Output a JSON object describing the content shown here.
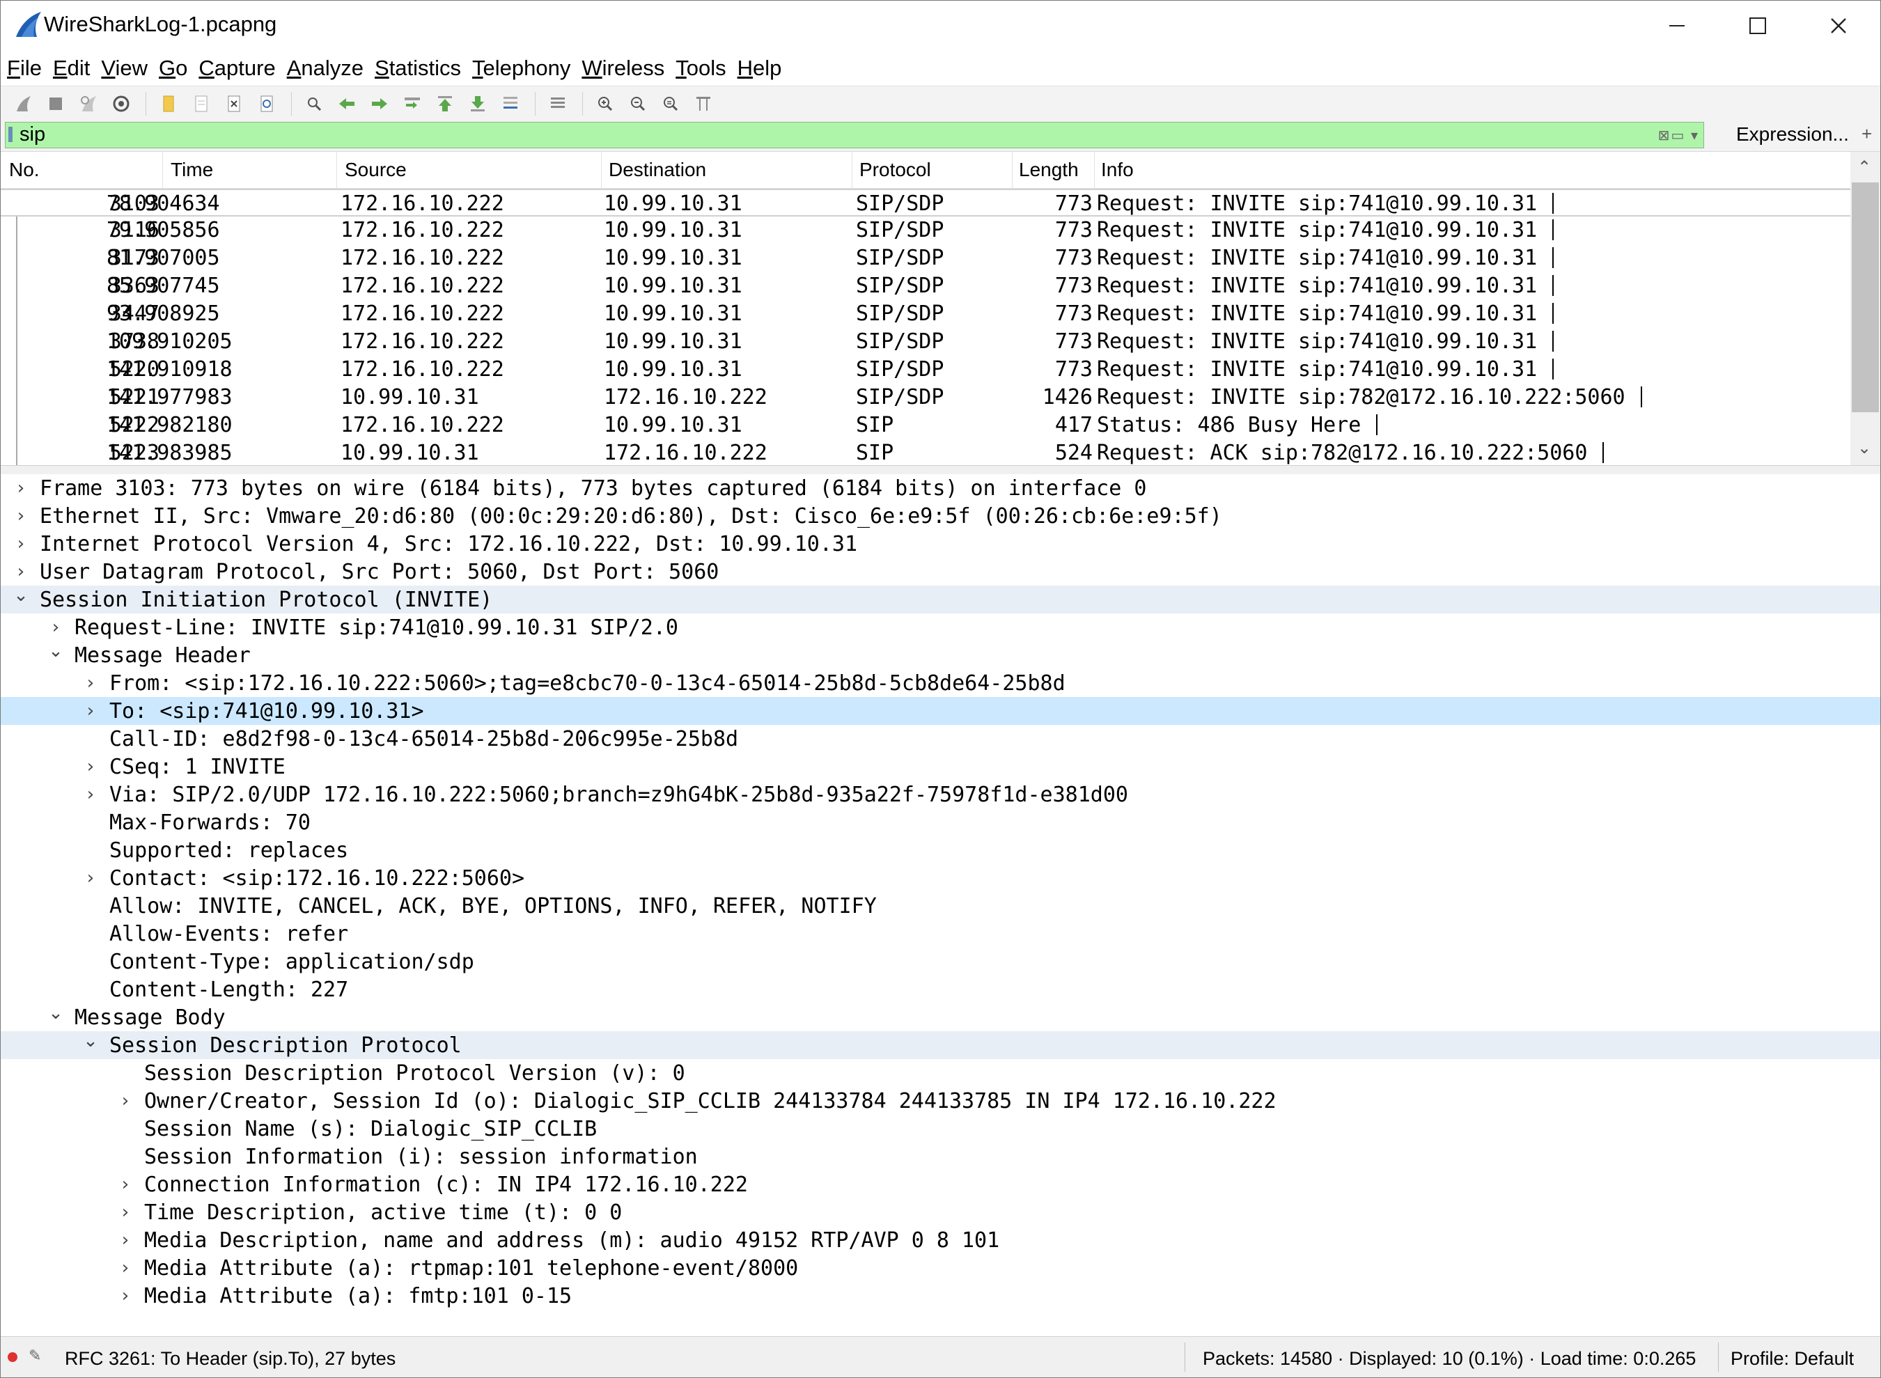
{
  "window": {
    "title": "WireSharkLog-1.pcapng"
  },
  "menu": [
    "File",
    "Edit",
    "View",
    "Go",
    "Capture",
    "Analyze",
    "Statistics",
    "Telephony",
    "Wireless",
    "Tools",
    "Help"
  ],
  "filter": {
    "value": "sip",
    "expression_label": "Expression...",
    "plus_label": "+"
  },
  "columns": [
    "No.",
    "Time",
    "Source",
    "Destination",
    "Protocol",
    "Length",
    "Info"
  ],
  "packets": [
    {
      "no": "3103",
      "time": "78.904634",
      "src": "172.16.10.222",
      "dst": "10.99.10.31",
      "proto": "SIP/SDP",
      "len": "773",
      "info": "Request: INVITE sip:741@10.99.10.31"
    },
    {
      "no": "3116",
      "time": "79.905856",
      "src": "172.16.10.222",
      "dst": "10.99.10.31",
      "proto": "SIP/SDP",
      "len": "773",
      "info": "Request: INVITE sip:741@10.99.10.31"
    },
    {
      "no": "3173",
      "time": "81.907005",
      "src": "172.16.10.222",
      "dst": "10.99.10.31",
      "proto": "SIP/SDP",
      "len": "773",
      "info": "Request: INVITE sip:741@10.99.10.31"
    },
    {
      "no": "3363",
      "time": "85.907745",
      "src": "172.16.10.222",
      "dst": "10.99.10.31",
      "proto": "SIP/SDP",
      "len": "773",
      "info": "Request: INVITE sip:741@10.99.10.31"
    },
    {
      "no": "3447",
      "time": "93.908925",
      "src": "172.16.10.222",
      "dst": "10.99.10.31",
      "proto": "SIP/SDP",
      "len": "773",
      "info": "Request: INVITE sip:741@10.99.10.31"
    },
    {
      "no": "3738",
      "time": "109.910205",
      "src": "172.16.10.222",
      "dst": "10.99.10.31",
      "proto": "SIP/SDP",
      "len": "773",
      "info": "Request: INVITE sip:741@10.99.10.31"
    },
    {
      "no": "5220",
      "time": "141.910918",
      "src": "172.16.10.222",
      "dst": "10.99.10.31",
      "proto": "SIP/SDP",
      "len": "773",
      "info": "Request: INVITE sip:741@10.99.10.31"
    },
    {
      "no": "5221",
      "time": "141.977983",
      "src": "10.99.10.31",
      "dst": "172.16.10.222",
      "proto": "SIP/SDP",
      "len": "1426",
      "info": "Request: INVITE sip:782@172.16.10.222:5060"
    },
    {
      "no": "5222",
      "time": "141.982180",
      "src": "172.16.10.222",
      "dst": "10.99.10.31",
      "proto": "SIP",
      "len": "417",
      "info": "Status: 486 Busy Here"
    },
    {
      "no": "5223",
      "time": "141.983985",
      "src": "10.99.10.31",
      "dst": "172.16.10.222",
      "proto": "SIP",
      "len": "524",
      "info": "Request: ACK sip:782@172.16.10.222:5060"
    }
  ],
  "details": [
    {
      "level": 0,
      "expander": "collapsed",
      "text": "Frame 3103: 773 bytes on wire (6184 bits), 773 bytes captured (6184 bits) on interface 0"
    },
    {
      "level": 0,
      "expander": "collapsed",
      "text": "Ethernet II, Src: Vmware_20:d6:80 (00:0c:29:20:d6:80), Dst: Cisco_6e:e9:5f (00:26:cb:6e:e9:5f)"
    },
    {
      "level": 0,
      "expander": "collapsed",
      "text": "Internet Protocol Version 4, Src: 172.16.10.222, Dst: 10.99.10.31"
    },
    {
      "level": 0,
      "expander": "collapsed",
      "text": "User Datagram Protocol, Src Port: 5060, Dst Port: 5060"
    },
    {
      "level": 0,
      "expander": "expanded",
      "text": "Session Initiation Protocol (INVITE)",
      "style": "grey"
    },
    {
      "level": 1,
      "expander": "collapsed",
      "text": "Request-Line: INVITE sip:741@10.99.10.31 SIP/2.0"
    },
    {
      "level": 1,
      "expander": "expanded",
      "text": "Message Header"
    },
    {
      "level": 2,
      "expander": "collapsed",
      "text": "From: <sip:172.16.10.222:5060>;tag=e8cbc70-0-13c4-65014-25b8d-5cb8de64-25b8d"
    },
    {
      "level": 2,
      "expander": "collapsed",
      "text": "To: <sip:741@10.99.10.31>",
      "style": "hl"
    },
    {
      "level": 2,
      "expander": "none",
      "text": "Call-ID: e8d2f98-0-13c4-65014-25b8d-206c995e-25b8d"
    },
    {
      "level": 2,
      "expander": "collapsed",
      "text": "CSeq: 1 INVITE"
    },
    {
      "level": 2,
      "expander": "collapsed",
      "text": "Via: SIP/2.0/UDP 172.16.10.222:5060;branch=z9hG4bK-25b8d-935a22f-75978f1d-e381d00"
    },
    {
      "level": 2,
      "expander": "none",
      "text": "Max-Forwards: 70"
    },
    {
      "level": 2,
      "expander": "none",
      "text": "Supported: replaces"
    },
    {
      "level": 2,
      "expander": "collapsed",
      "text": "Contact: <sip:172.16.10.222:5060>"
    },
    {
      "level": 2,
      "expander": "none",
      "text": "Allow: INVITE, CANCEL, ACK, BYE, OPTIONS, INFO, REFER, NOTIFY"
    },
    {
      "level": 2,
      "expander": "none",
      "text": "Allow-Events: refer"
    },
    {
      "level": 2,
      "expander": "none",
      "text": "Content-Type: application/sdp"
    },
    {
      "level": 2,
      "expander": "none",
      "text": "Content-Length: 227"
    },
    {
      "level": 1,
      "expander": "expanded",
      "text": "Message Body"
    },
    {
      "level": 2,
      "expander": "expanded",
      "text": "Session Description Protocol",
      "style": "grey"
    },
    {
      "level": 3,
      "expander": "none",
      "text": "Session Description Protocol Version (v): 0"
    },
    {
      "level": 3,
      "expander": "collapsed",
      "text": "Owner/Creator, Session Id (o): Dialogic_SIP_CCLIB 244133784 244133785 IN IP4 172.16.10.222"
    },
    {
      "level": 3,
      "expander": "none",
      "text": "Session Name (s): Dialogic_SIP_CCLIB"
    },
    {
      "level": 3,
      "expander": "none",
      "text": "Session Information (i): session information"
    },
    {
      "level": 3,
      "expander": "collapsed",
      "text": "Connection Information (c): IN IP4 172.16.10.222"
    },
    {
      "level": 3,
      "expander": "collapsed",
      "text": "Time Description, active time (t): 0 0"
    },
    {
      "level": 3,
      "expander": "collapsed",
      "text": "Media Description, name and address (m): audio 49152 RTP/AVP 0 8 101"
    },
    {
      "level": 3,
      "expander": "collapsed",
      "text": "Media Attribute (a): rtpmap:101 telephone-event/8000"
    },
    {
      "level": 3,
      "expander": "collapsed",
      "text": "Media Attribute (a): fmtp:101 0-15"
    }
  ],
  "status": {
    "field_info": "RFC 3261: To Header (sip.To), 27 bytes",
    "packets": "Packets: 14580 · Displayed: 10 (0.1%) · Load time: 0:0.265",
    "profile": "Profile: Default"
  },
  "icons": {
    "app": "wireshark-fin-icon",
    "toolbar": [
      "start-capture-icon",
      "stop-capture-icon",
      "restart-capture-icon",
      "capture-options-icon",
      "open-file-icon",
      "save-file-icon",
      "close-file-icon",
      "reload-file-icon",
      "find-packet-icon",
      "go-back-icon",
      "go-forward-icon",
      "go-to-packet-icon",
      "first-packet-icon",
      "last-packet-icon",
      "autoscroll-icon",
      "colorize-icon",
      "zoom-in-icon",
      "zoom-out-icon",
      "normal-size-icon",
      "resize-columns-icon"
    ]
  },
  "colors": {
    "filter_valid": "#aff5a9",
    "selected_detail": "#cce8ff",
    "accent": "#1f5fb3"
  }
}
